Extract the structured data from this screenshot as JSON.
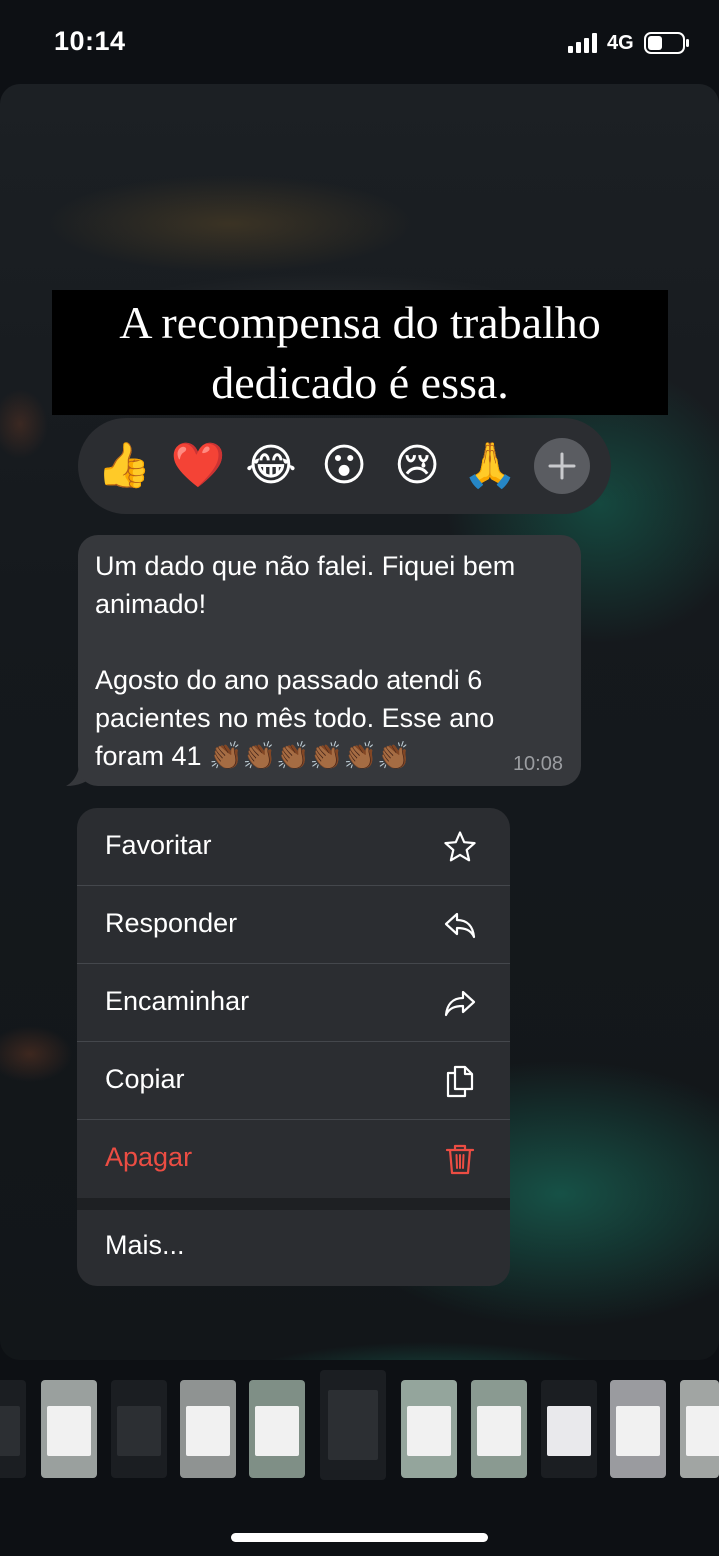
{
  "status_bar": {
    "time": "10:14",
    "network": "4G"
  },
  "sticker": {
    "caption_line1": "A recompensa do trabalho",
    "caption_line2": "dedicado é essa."
  },
  "reactions": {
    "items": [
      {
        "emoji": "👍",
        "name": "thumbs-up"
      },
      {
        "emoji": "❤️",
        "name": "heart"
      },
      {
        "emoji": "😂",
        "name": "tears-of-joy"
      },
      {
        "emoji": "😮",
        "name": "surprised"
      },
      {
        "emoji": "😢",
        "name": "crying"
      },
      {
        "emoji": "🙏",
        "name": "praying-hands"
      }
    ],
    "add_icon": "plus-icon"
  },
  "message": {
    "text": "Um dado que não falei. Fiquei bem animado!\n\nAgosto do ano passado atendi 6 pacientes no mês todo. Esse ano foram 41 👏🏾👏🏾👏🏾👏🏾👏🏾👏🏾",
    "time": "10:08"
  },
  "menu": {
    "items": [
      {
        "label": "Favoritar",
        "icon": "star-icon"
      },
      {
        "label": "Responder",
        "icon": "reply-icon"
      },
      {
        "label": "Encaminhar",
        "icon": "forward-icon"
      },
      {
        "label": "Copiar",
        "icon": "copy-icon"
      },
      {
        "label": "Apagar",
        "icon": "trash-icon"
      }
    ],
    "more_label": "Mais..."
  },
  "colors": {
    "danger": "#ec4d43",
    "menu_bg": "#2b2d31",
    "bubble_bg": "#36383c"
  }
}
